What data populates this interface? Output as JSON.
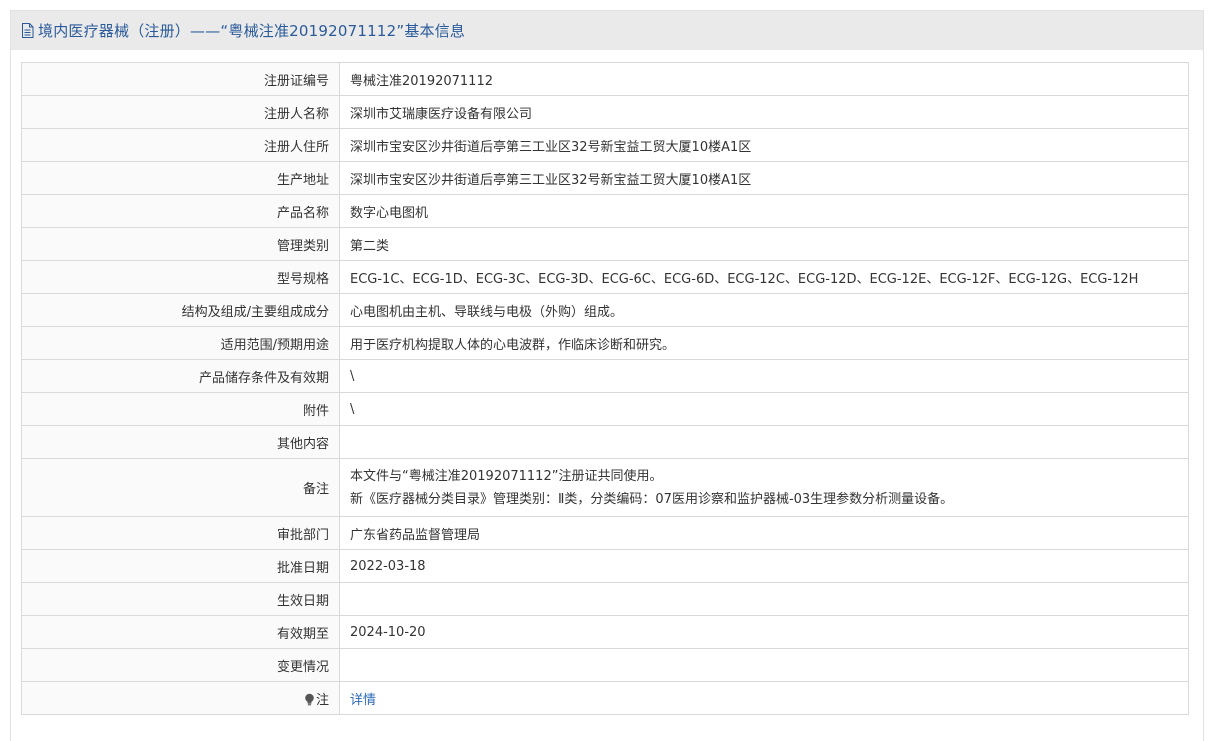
{
  "header": {
    "title": "境内医疗器械（注册）——“粤械注准20192071112”基本信息",
    "icon": "document-icon"
  },
  "rows": [
    {
      "label": "注册证编号",
      "value": "粤械注准20192071112"
    },
    {
      "label": "注册人名称",
      "value": "深圳市艾瑞康医疗设备有限公司"
    },
    {
      "label": "注册人住所",
      "value": "深圳市宝安区沙井街道后亭第三工业区32号新宝益工贸大厦10楼A1区"
    },
    {
      "label": "生产地址",
      "value": "深圳市宝安区沙井街道后亭第三工业区32号新宝益工贸大厦10楼A1区"
    },
    {
      "label": "产品名称",
      "value": "数字心电图机"
    },
    {
      "label": "管理类别",
      "value": "第二类"
    },
    {
      "label": "型号规格",
      "value": "ECG-1C、ECG-1D、ECG-3C、ECG-3D、ECG-6C、ECG-6D、ECG-12C、ECG-12D、ECG-12E、ECG-12F、ECG-12G、ECG-12H"
    },
    {
      "label": "结构及组成/主要组成成分",
      "value": "心电图机由主机、导联线与电极（外购）组成。"
    },
    {
      "label": "适用范围/预期用途",
      "value": "用于医疗机构提取人体的心电波群，作临床诊断和研究。"
    },
    {
      "label": "产品储存条件及有效期",
      "value": "\\"
    },
    {
      "label": "附件",
      "value": "\\"
    },
    {
      "label": "其他内容",
      "value": ""
    }
  ],
  "remark": {
    "label": "备注",
    "line1": "本文件与“粤械注准20192071112”注册证共同使用。",
    "line2": "新《医疗器械分类目录》管理类别：Ⅱ类，分类编码：07医用诊察和监护器械-03生理参数分析测量设备。"
  },
  "rows2": [
    {
      "label": "审批部门",
      "value": "广东省药品监督管理局"
    },
    {
      "label": "批准日期",
      "value": "2022-03-18"
    },
    {
      "label": "生效日期",
      "value": ""
    },
    {
      "label": "有效期至",
      "value": "2024-10-20"
    },
    {
      "label": "变更情况",
      "value": ""
    }
  ],
  "note": {
    "label": "注",
    "icon": "lightbulb-icon",
    "link": "详情"
  },
  "colors": {
    "header_bg": "#eaeaea",
    "title": "#2a5a9a",
    "link": "#2a6ab8",
    "border": "#d9d9d9"
  }
}
